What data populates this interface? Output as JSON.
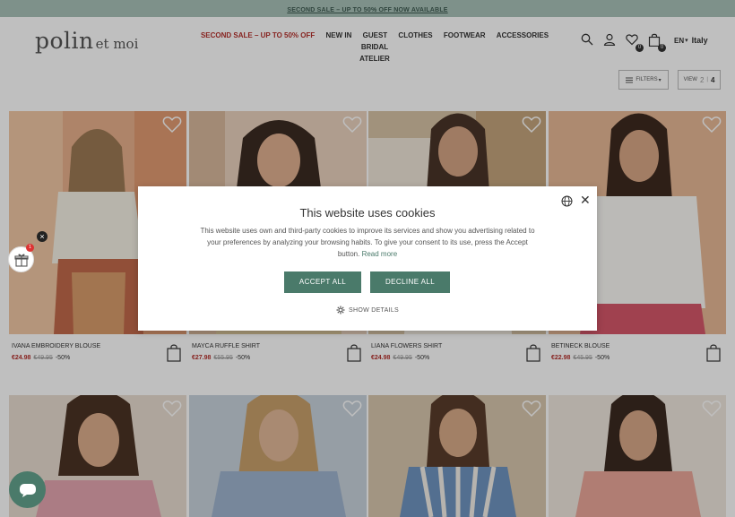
{
  "promo": {
    "text": "SECOND SALE – UP TO 50% OFF NOW AVAILABLE"
  },
  "header": {
    "logo": {
      "main": "polin",
      "sub": "et moi"
    },
    "nav": [
      {
        "label": "SECOND SALE – UP TO 50% OFF",
        "sale": true
      },
      {
        "label": "NEW IN"
      },
      {
        "label": "GUEST"
      },
      {
        "label": "CLOTHES"
      },
      {
        "label": "FOOTWEAR"
      },
      {
        "label": "ACCESSORIES"
      },
      {
        "label": "BRIDAL"
      },
      {
        "label": "ATELIER"
      }
    ],
    "wishlist_count": "0",
    "cart_count": "0",
    "language": "EN",
    "country": "Italy"
  },
  "toolbar": {
    "filters_label": "FILTERS",
    "view_label": "VIEW",
    "view_options": [
      "2",
      "4"
    ],
    "view_selected": "4"
  },
  "products": [
    {
      "name": "IVANA EMBROIDERY BLOUSE",
      "price": "€24.98",
      "old_price": "€49.95",
      "discount": "-50%"
    },
    {
      "name": "MAYCA RUFFLE SHIRT",
      "price": "€27.98",
      "old_price": "€55.95",
      "discount": "-50%"
    },
    {
      "name": "LIANA FLOWERS SHIRT",
      "price": "€24.98",
      "old_price": "€49.95",
      "discount": "-50%"
    },
    {
      "name": "BETINECK BLOUSE",
      "price": "€22.98",
      "old_price": "€45.95",
      "discount": "-50%"
    }
  ],
  "cookie_dialog": {
    "title": "This website uses cookies",
    "body": "This website uses own and third-party cookies to improve its services and show you advertising related to your preferences by analyzing your browsing habits. To give your consent to its use, press the Accept button.",
    "read_more": "Read more",
    "accept": "ACCEPT ALL",
    "decline": "DECLINE ALL",
    "show_details": "SHOW DETAILS"
  },
  "gift_widget": {
    "badge": "1"
  },
  "colors": {
    "promo_bg": "#a8c2b8",
    "sale_red": "#b5312c",
    "brand_green": "#4a7a6a"
  }
}
